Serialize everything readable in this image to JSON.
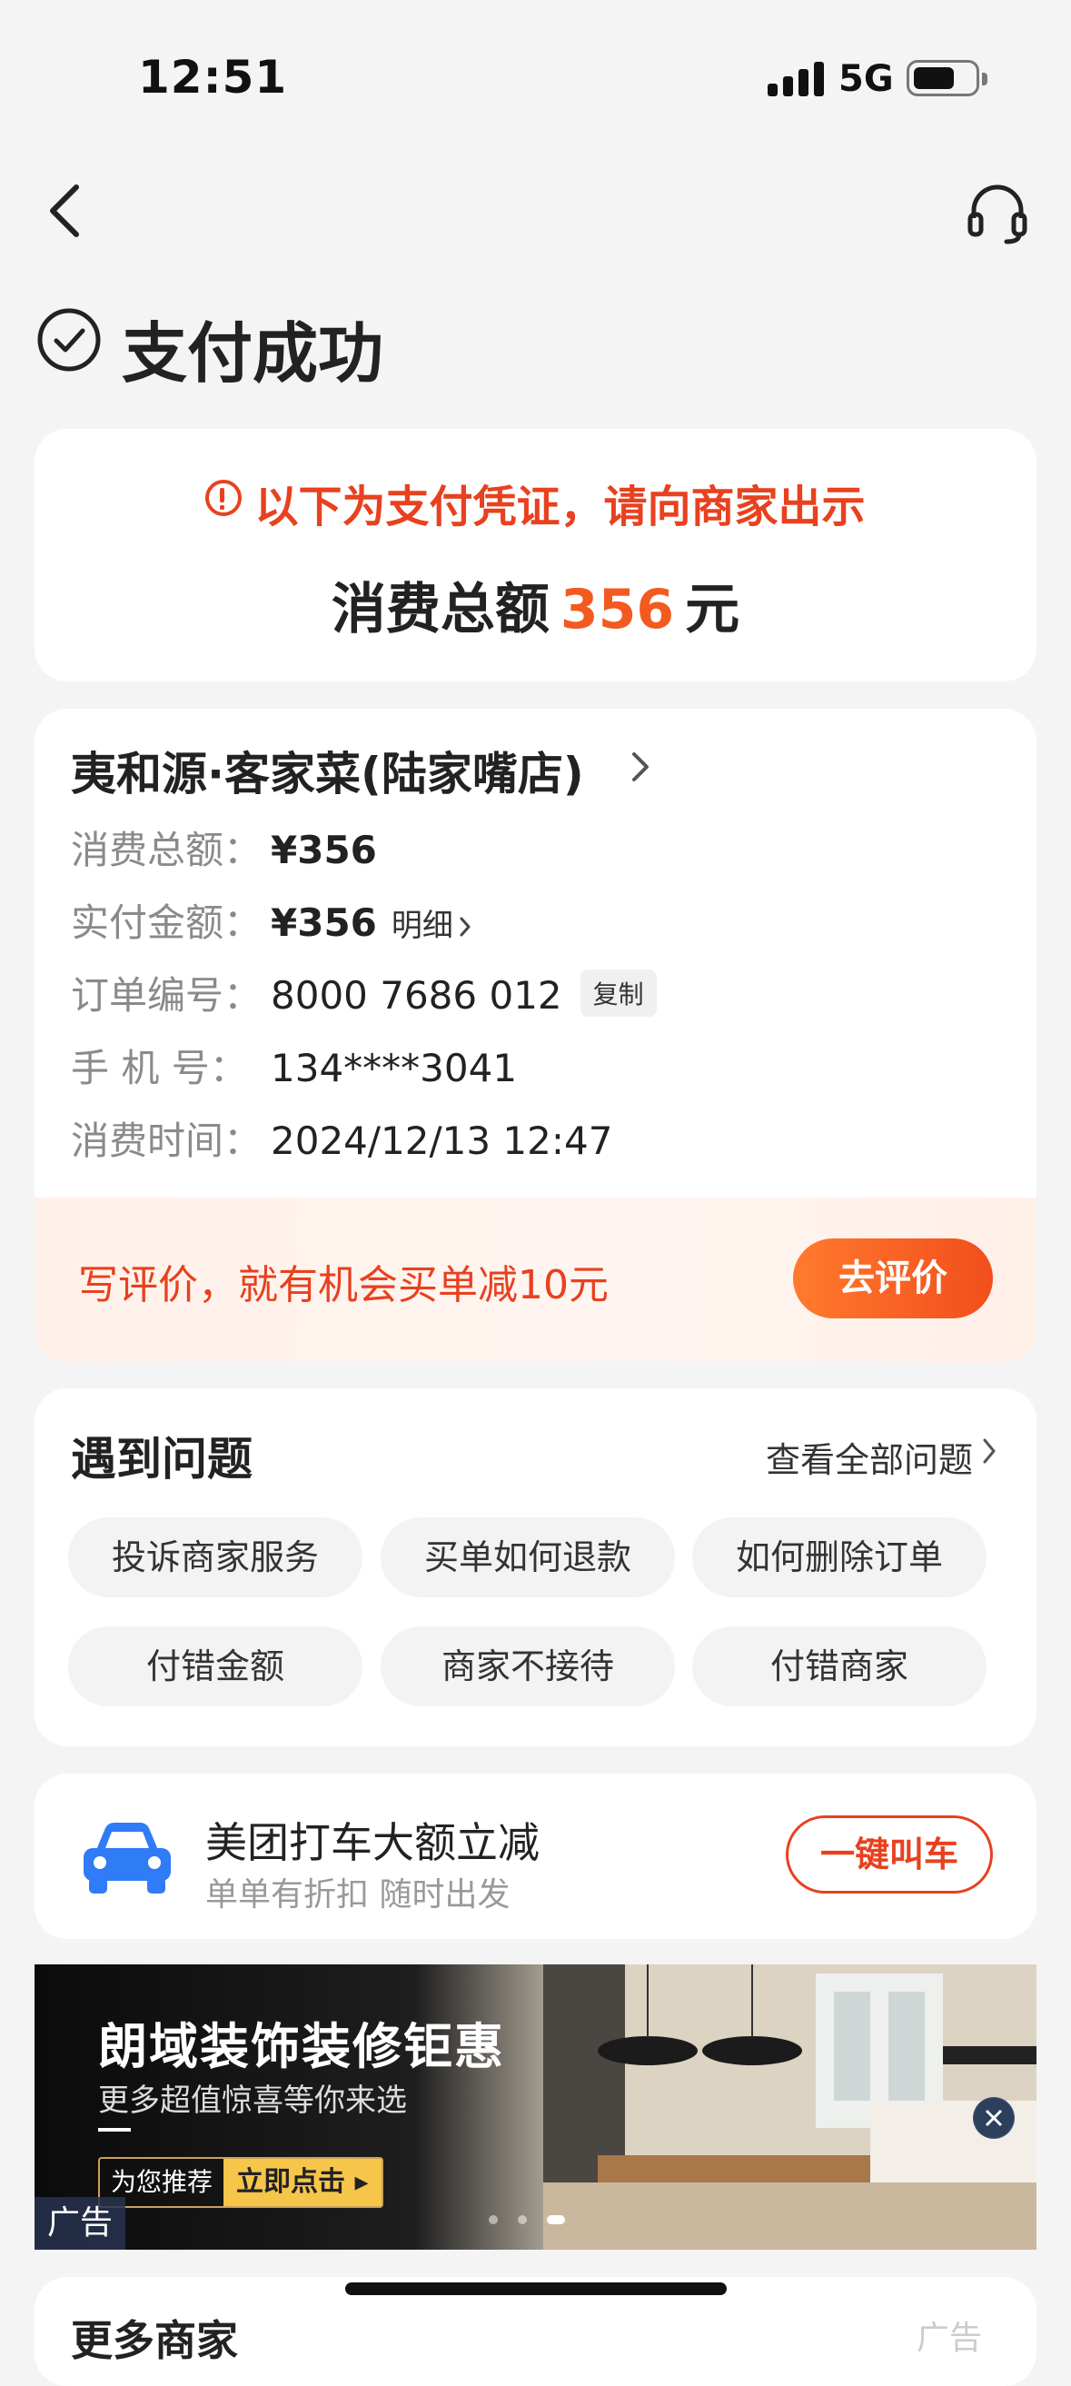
{
  "status_bar": {
    "time": "12:51",
    "network": "5G"
  },
  "header": {
    "title": "支付成功"
  },
  "voucher": {
    "notice": "以下为支付凭证，请向商家出示",
    "total_label": "消费总额",
    "total_amount": "356",
    "total_unit": "元"
  },
  "order": {
    "merchant": "夷和源·客家菜(陆家嘴店)",
    "rows": [
      {
        "label": "消费总额：",
        "value": "¥356"
      },
      {
        "label": "实付金额：",
        "value": "¥356"
      },
      {
        "label": "订单编号：",
        "value": "8000 7686 012"
      },
      {
        "label": "手 机 号：",
        "value": "134****3041"
      },
      {
        "label": "消费时间：",
        "value": "2024/12/13 12:47"
      }
    ],
    "detail_link": "明细",
    "copy_label": "复制",
    "review_prompt": "写评价，就有机会买单减10元",
    "review_button": "去评价"
  },
  "problems": {
    "title": "遇到问题",
    "view_all": "查看全部问题",
    "chips": [
      "投诉商家服务",
      "买单如何退款",
      "如何删除订单",
      "付错金额",
      "商家不接待",
      "付错商家"
    ]
  },
  "ride": {
    "title": "美团打车大额立减",
    "subtitle": "单单有折扣 随时出发",
    "button": "一键叫车"
  },
  "ad": {
    "title": "朗域装饰装修钜惠",
    "subtitle": "更多超值惊喜等你来选",
    "recommend": "为您推荐",
    "cta": "立即点击 ▸",
    "badge": "广告",
    "active_slide": 3,
    "slide_count": 3
  },
  "more": {
    "title": "更多商家",
    "right": "广告"
  },
  "colors": {
    "accent": "#f25a1f",
    "warning": "#e8411f",
    "ride_blue": "#2f7cf6"
  }
}
